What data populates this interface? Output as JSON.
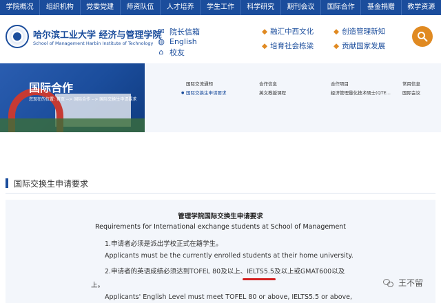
{
  "topnav": [
    "学院概况",
    "组织机构",
    "党委党建",
    "师资队伍",
    "人才培养",
    "学生工作",
    "科学研究",
    "期刊会议",
    "国际合作",
    "基金捐赠",
    "教学资源"
  ],
  "header": {
    "school_cn": "哈尔滨工业大学 经济与管理学院",
    "school_en": "School of Management Harbin Institute of Technology",
    "links": [
      {
        "label": "院长信箱",
        "icon": "mail-icon"
      },
      {
        "label": "English",
        "icon": "globe-icon"
      },
      {
        "label": "校友",
        "icon": "alumni-icon"
      }
    ],
    "slogans": [
      "融汇中西文化",
      "创造管理新知",
      "培育社会栋梁",
      "贡献国家发展"
    ]
  },
  "banner": {
    "title": "国际合作",
    "breadcrumb": "您现在的位置: 首页 --> 国际合作 --> 国际交换生申请要求",
    "columns": [
      {
        "items": [
          "国际交流通知",
          "国际交换生申请要求"
        ],
        "active": 1
      },
      {
        "items": [
          "合作信息",
          "英文教授课程"
        ],
        "active": -1
      },
      {
        "items": [
          "合作项目",
          "经济管理量化技术硕士(QTE..."
        ],
        "active": -1
      },
      {
        "items": [
          "常用信息",
          "国际会议"
        ],
        "active": -1
      }
    ]
  },
  "section_title": "国际交换生申请要求",
  "article": {
    "title": "管理学院国际交换生申请要求",
    "subtitle": "Requirements for International exchange students at School of Management",
    "lines": [
      "1.申请者必须是派出学校正式在籍学生。",
      "Applicants must be the currently enrolled students at their home university.",
      "2.申请者的英语成绩必须达到TOFEL 80及以上、IELTS5.5及以上或GMAT600以及",
      "上。",
      "Applicants' English Level must meet TOFEL 80 or above, IELTS5.5 or above,"
    ]
  },
  "watermark": "王不留",
  "colors": {
    "brand": "#1b4d9c",
    "accent": "#e08a22",
    "highlight": "#d42020"
  }
}
